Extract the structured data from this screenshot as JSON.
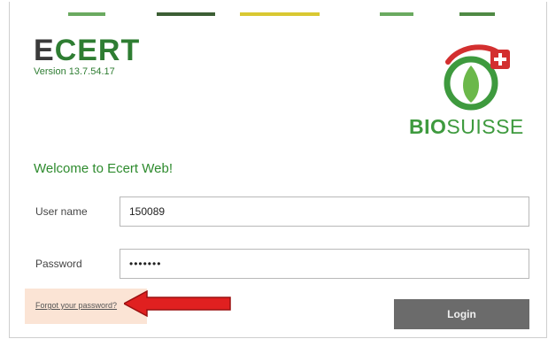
{
  "header": {
    "logo_text_first": "E",
    "logo_text_rest": "CERT",
    "version": "Version 13.7.54.17",
    "partner_logo_bold": "BIO",
    "partner_logo_rest": "SUISSE"
  },
  "colors": {
    "brand_green": "#2e7d32",
    "bar_colors": [
      "#6aaa60",
      "#3c5e34",
      "#d9c832",
      "#6aaa60",
      "#4f8a44"
    ],
    "login_button": "#6b6b6b",
    "annotation_arrow": "#e02020",
    "highlight": "#fbe4d5"
  },
  "form": {
    "welcome": "Welcome to Ecert Web!",
    "username_label": "User name",
    "username_value": "150089",
    "password_label": "Password",
    "password_value": "•••••••",
    "forgot_link": "Forgot your password?",
    "login_label": "Login"
  },
  "icons": {
    "partner_logo": "biosuisse-logo",
    "annotation": "red-arrow-left"
  }
}
